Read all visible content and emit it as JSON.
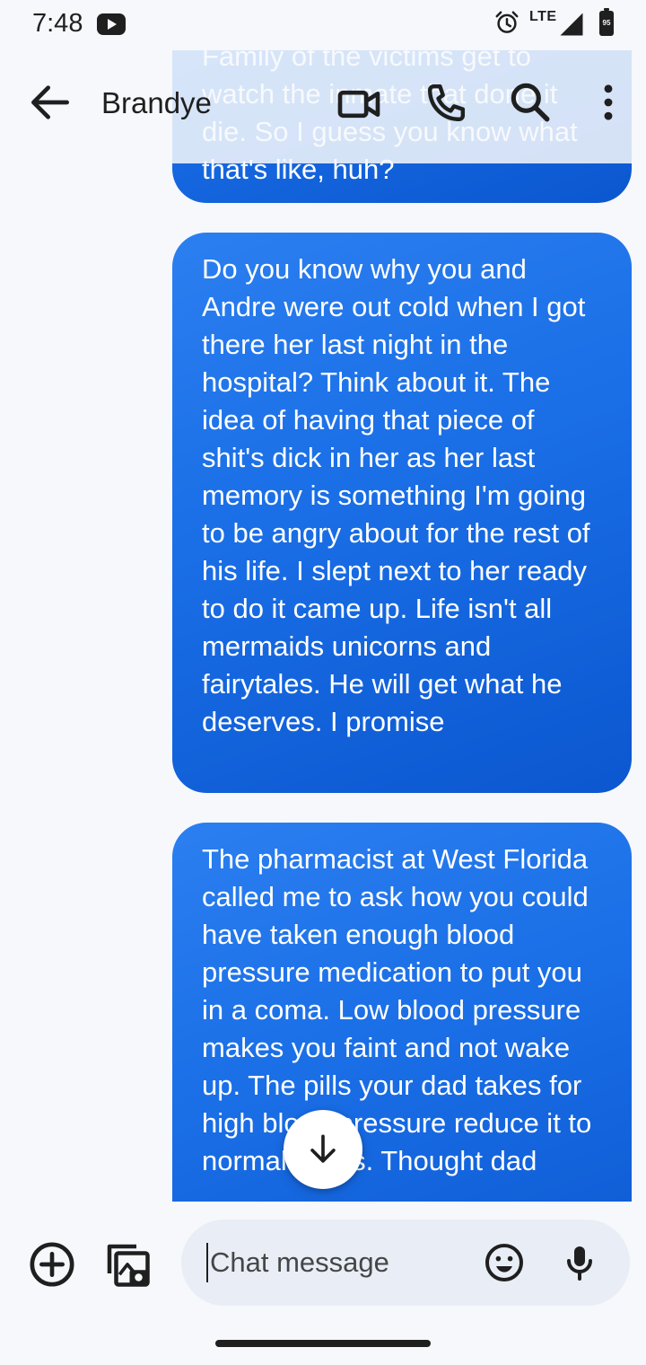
{
  "status_bar": {
    "time": "7:48",
    "network": "LTE",
    "battery_level": "95",
    "icons": [
      "youtube-icon",
      "alarm-icon",
      "signal-icon",
      "battery-icon"
    ]
  },
  "app_bar": {
    "contact_name": "Brandye",
    "icons": [
      "back-arrow-icon",
      "video-call-icon",
      "phone-icon",
      "search-icon",
      "more-vert-icon"
    ]
  },
  "messages": [
    {
      "direction": "outgoing",
      "text": "going to watch the rest kill him. Family of the victims get to watch the inmate that done it die. So I guess you know what that's like, huh?"
    },
    {
      "direction": "outgoing",
      "text": "Do you know why you and Andre were out cold when I got there her last night in the hospital? Think about it. The idea of having that piece of shit's dick in her as her last memory is something I'm going to be angry about for the rest of his life. I slept next to her ready to do it came up. Life isn't all mermaids unicorns and fairytales. He will get what he deserves. I promise"
    },
    {
      "direction": "outgoing",
      "text": "The pharmacist at West Florida called me to ask how you could have taken enough blood pressure medication to put you in a coma. Low blood pressure makes you faint and not wake up. The pills your dad takes for high blood pressure reduce it to normal levels. Thought dad"
    }
  ],
  "compose": {
    "placeholder": "Chat message",
    "value": "",
    "icons": [
      "add-circle-icon",
      "gallery-icon",
      "emoji-icon",
      "mic-icon"
    ]
  },
  "colors": {
    "background": "#f6f8fc",
    "bubble_gradient_start": "#2b7ff0",
    "bubble_gradient_end": "#0b57d0",
    "bubble_text": "#ffffff",
    "compose_field": "#e9eef6",
    "icon": "#1f1f1f"
  }
}
